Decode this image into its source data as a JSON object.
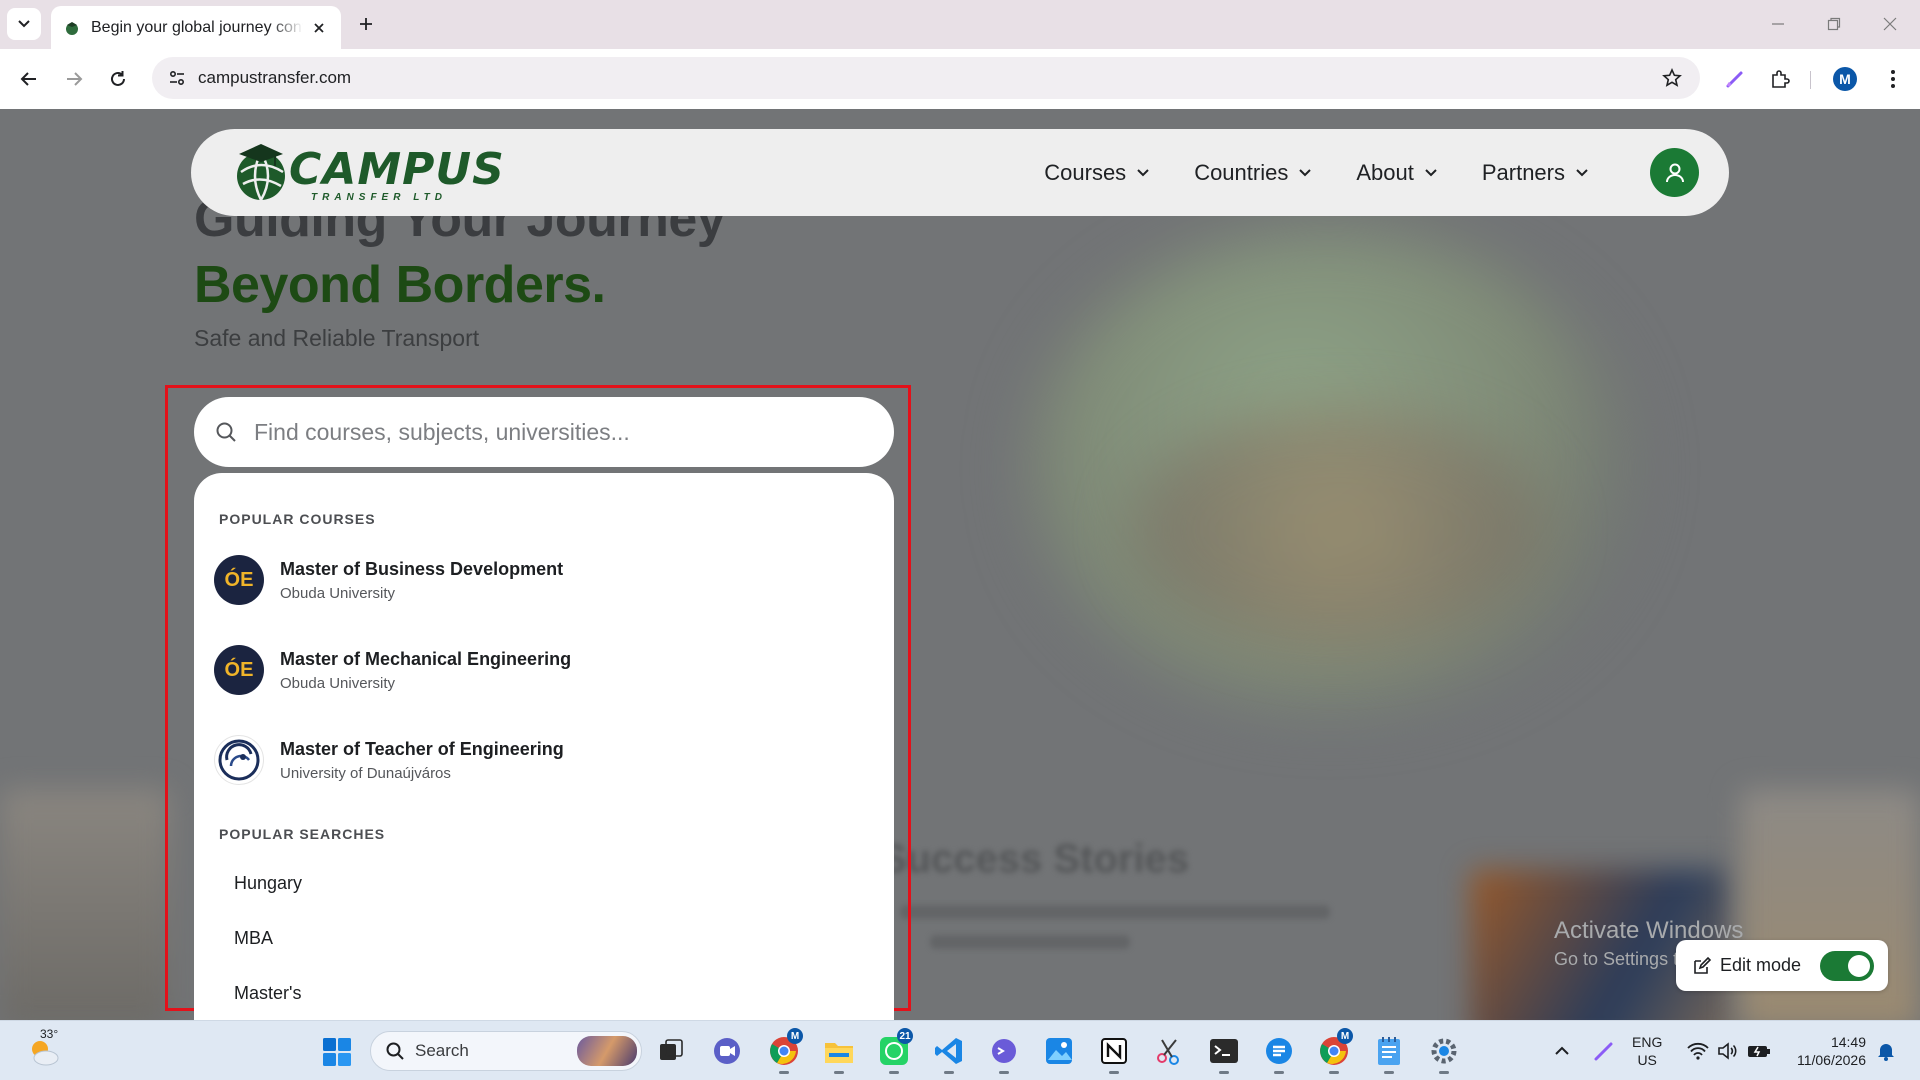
{
  "browser": {
    "tab_title": "Begin your global journey confidently",
    "url": "campustransfer.com",
    "profile_initial": "M"
  },
  "site": {
    "logo_text": "CAMPUS",
    "logo_sub": "TRANSFER LTD",
    "nav": [
      "Courses",
      "Countries",
      "About",
      "Partners"
    ],
    "hero_line1": "Guiding Your Journey",
    "hero_line2": "Beyond Borders.",
    "hero_sub": "Safe and Reliable Transport",
    "stories_heading": "Success Stories"
  },
  "search": {
    "placeholder": "Find courses, subjects, universities...",
    "value": "",
    "popular_courses_heading": "POPULAR COURSES",
    "courses": [
      {
        "title": "Master of Business Development",
        "university": "Obuda University",
        "logo": "ÓE"
      },
      {
        "title": "Master of Mechanical Engineering",
        "university": "Obuda University",
        "logo": "ÓE"
      },
      {
        "title": "Master of Teacher of Engineering",
        "university": "University of Dunaújváros",
        "logo": ""
      }
    ],
    "popular_searches_heading": "POPULAR SEARCHES",
    "searches": [
      "Hungary",
      "MBA",
      "Master's"
    ]
  },
  "overlay": {
    "activate_title": "Activate Windows",
    "activate_sub": "Go to Settings to activate Windows.",
    "edit_mode_label": "Edit mode",
    "edit_mode_on": true
  },
  "taskbar": {
    "weather_temp": "33°",
    "search_label": "Search",
    "chrome_badge": "M",
    "whatsapp_badge": "21",
    "chrome2_badge": "M",
    "lang_line1": "ENG",
    "lang_line2": "US",
    "time": "14:49",
    "date": "11/06/2026"
  },
  "colors": {
    "brand_green": "#1b7a35",
    "hero_green": "#1d4a14",
    "highlight_red": "#e3111a",
    "obuda_navy": "#1b2440",
    "obuda_gold": "#f0b429"
  }
}
